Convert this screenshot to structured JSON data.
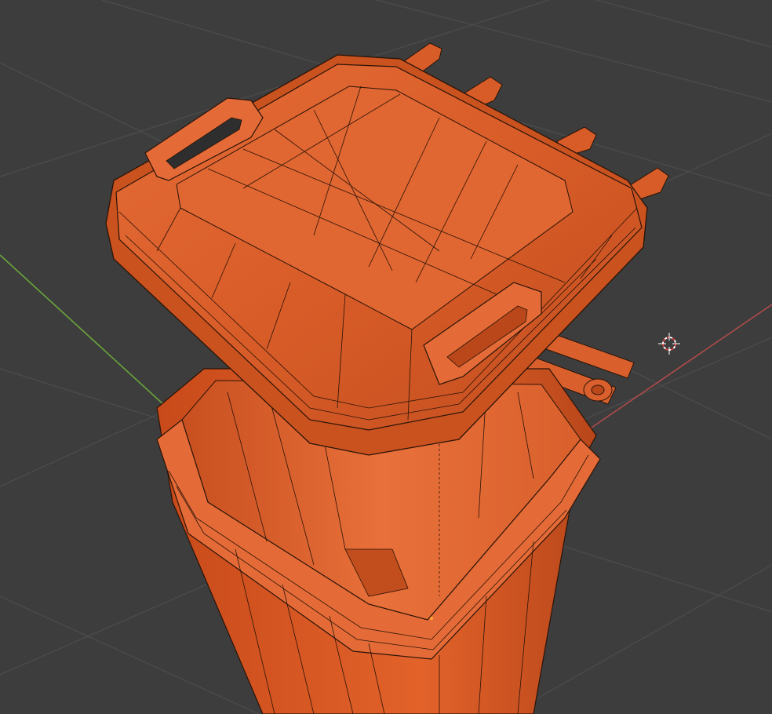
{
  "viewport": {
    "background": "#3d3d3d",
    "grid_color": "#4a4a4a",
    "x_axis_color": "#b04a4a",
    "y_axis_color": "#6aa53a"
  },
  "object": {
    "name": "wheelie-bin",
    "body_color": "#e2622a",
    "body_dark": "#b9471a",
    "body_light": "#f07a45",
    "wire_color": "#2a1408",
    "selected_vertex_color": "#ffaa33"
  },
  "cursor": {
    "icon": "3d-cursor-icon",
    "ring_red": "#d94040",
    "ring_white": "#ffffff"
  }
}
